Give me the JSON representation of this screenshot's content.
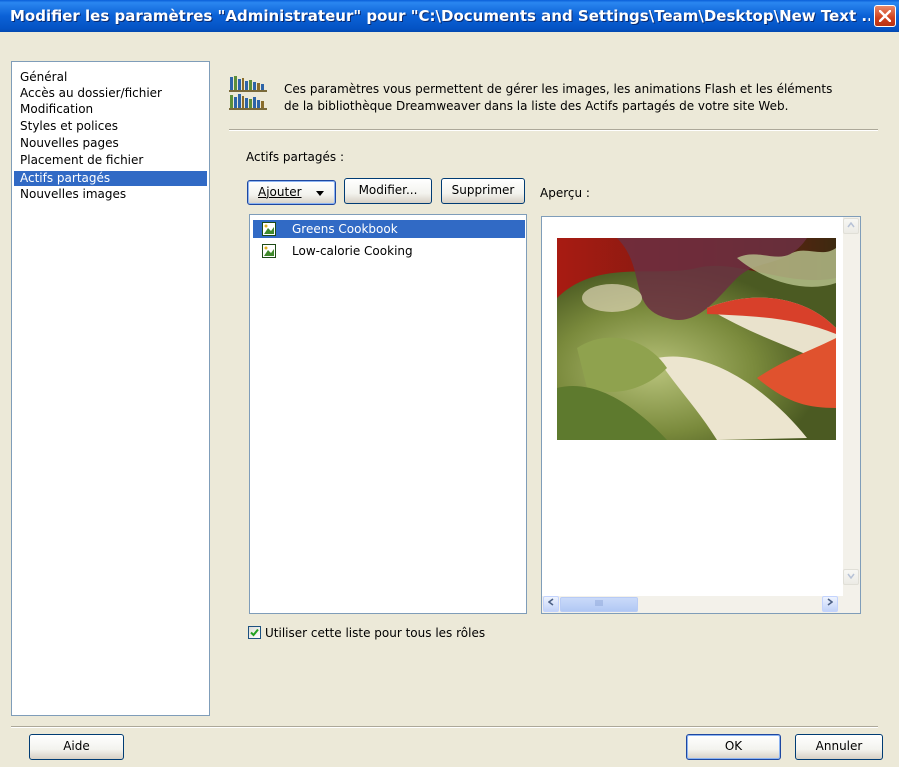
{
  "window": {
    "title": "Modifier les paramètres \"Administrateur\" pour \"C:\\Documents and Settings\\Team\\Desktop\\New Text ..."
  },
  "sidebar": {
    "items": [
      {
        "label": "Général"
      },
      {
        "label": "Accès au dossier/fichier"
      },
      {
        "label": "Modification"
      },
      {
        "label": "Styles et polices"
      },
      {
        "label": "Nouvelles pages"
      },
      {
        "label": "Placement de fichier"
      },
      {
        "label": "Actifs partagés",
        "selected": true
      },
      {
        "label": "Nouvelles images"
      }
    ]
  },
  "header": {
    "icon": "library-books-icon",
    "description_line1": "Ces paramètres vous permettent de gérer les images, les animations Flash et les éléments",
    "description_line2": "de la bibliothèque Dreamweaver dans la liste des Actifs partagés de votre site Web."
  },
  "assets": {
    "label": "Actifs partagés :",
    "add_button": "Ajouter",
    "modify_button": "Modifier...",
    "delete_button": "Supprimer",
    "items": [
      {
        "label": "Greens Cookbook",
        "icon": "image-asset-icon",
        "selected": true
      },
      {
        "label": "Low-calorie Cooking",
        "icon": "image-asset-icon",
        "selected": false
      }
    ]
  },
  "preview": {
    "label": "Aperçu :",
    "image": "salad-photo"
  },
  "options": {
    "use_list_for_all_roles": "Utiliser cette liste pour tous les rôles",
    "use_list_checked": true
  },
  "footer": {
    "help_button": "Aide",
    "ok_button": "OK",
    "cancel_button": "Annuler"
  },
  "colors": {
    "titlebar": "#0b61d6",
    "selection": "#316ac5",
    "dialog_bg": "#ece9d8",
    "close_button": "#d0401c"
  }
}
